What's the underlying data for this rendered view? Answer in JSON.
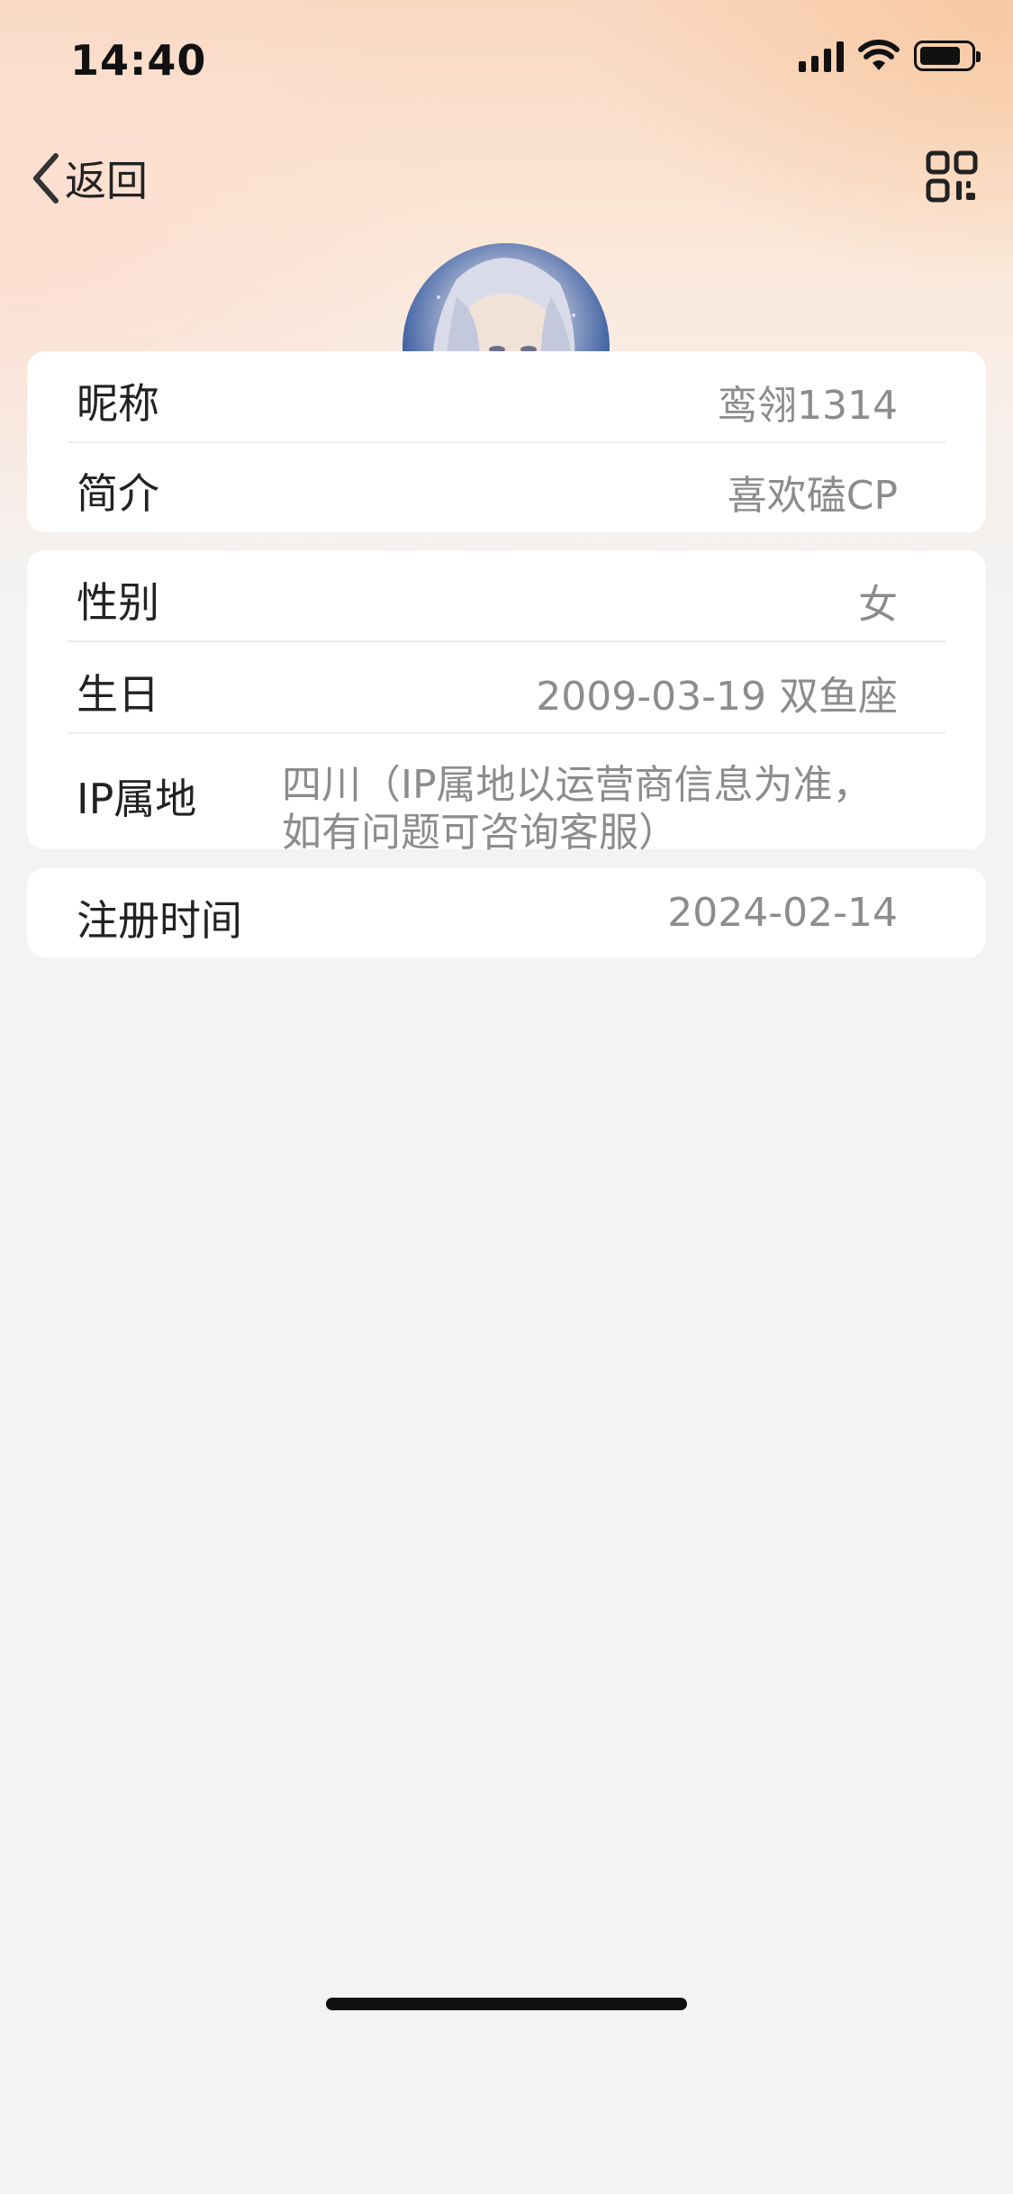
{
  "status_bar": {
    "time": "14:40",
    "icons": [
      "signal-icon",
      "wifi-icon",
      "battery-icon"
    ]
  },
  "nav": {
    "back_label": "返回",
    "back_icon": "chevron-left-icon",
    "qr_icon": "qr-code-icon"
  },
  "profile": {
    "avatar": "user-avatar"
  },
  "cards": {
    "basic": {
      "nickname_label": "昵称",
      "nickname_value": "鸾翎1314",
      "bio_label": "简介",
      "bio_value": "喜欢磕CP"
    },
    "details": {
      "gender_label": "性别",
      "gender_value": "女",
      "birthday_label": "生日",
      "birthday_value": "2009-03-19 双鱼座",
      "ip_label": "IP属地",
      "ip_value_line1": "四川（IP属地以运营商信息为准，",
      "ip_value_line2": "如有问题可咨询客服）"
    },
    "registration": {
      "reg_label": "注册时间",
      "reg_value": "2024-02-14"
    }
  },
  "colors": {
    "page_background": "#f3f3f3",
    "card_background": "#ffffff",
    "label_text": "#222222",
    "value_text": "#8c8c8c",
    "header_gradient_warm": "#f7c8a0"
  }
}
